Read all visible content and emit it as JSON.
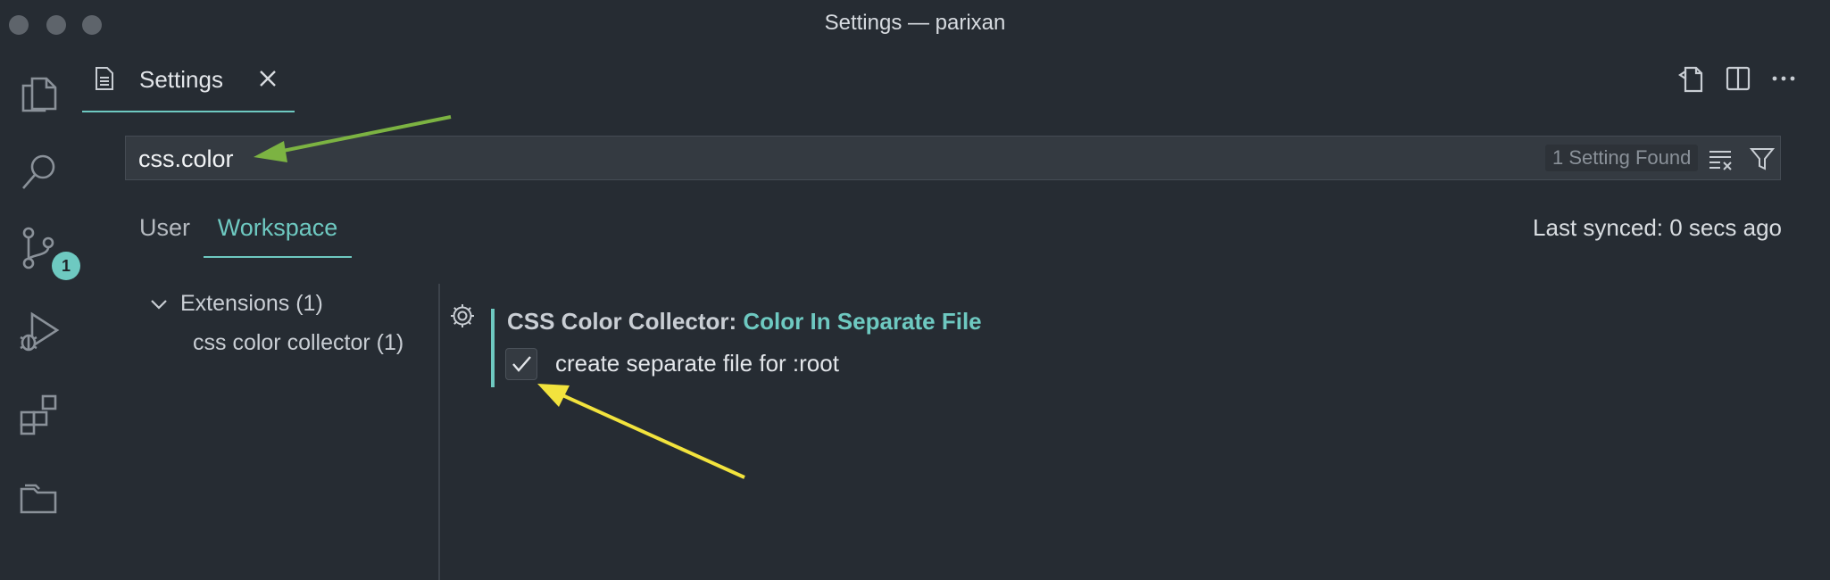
{
  "window": {
    "title": "Settings — parixan"
  },
  "activity_bar": {
    "items": [
      {
        "icon": "files-icon"
      },
      {
        "icon": "search-icon"
      },
      {
        "icon": "source-control-icon",
        "badge": "1"
      },
      {
        "icon": "run-debug-icon"
      },
      {
        "icon": "extensions-icon"
      },
      {
        "icon": "folder-icon"
      }
    ]
  },
  "tab": {
    "label": "Settings",
    "icon": "settings-file-icon"
  },
  "editor_actions": [
    "open-settings-json-icon",
    "split-editor-icon",
    "more-actions-icon"
  ],
  "search": {
    "value": "css.color",
    "results": "1 Setting Found"
  },
  "scopes": {
    "user": "User",
    "workspace": "Workspace",
    "active": "Workspace"
  },
  "sync": {
    "status": "Last synced: 0 secs ago"
  },
  "toc": {
    "group": "Extensions (1)",
    "item": "css color collector (1)"
  },
  "setting": {
    "category": "CSS Color Collector: ",
    "name": "Color In Separate File",
    "checked": true,
    "description": "create separate file for :root"
  },
  "colors": {
    "accent": "#6ec9c1",
    "background": "#262c33",
    "green_arrow": "#7cb342",
    "yellow_arrow": "#f2e33d"
  }
}
